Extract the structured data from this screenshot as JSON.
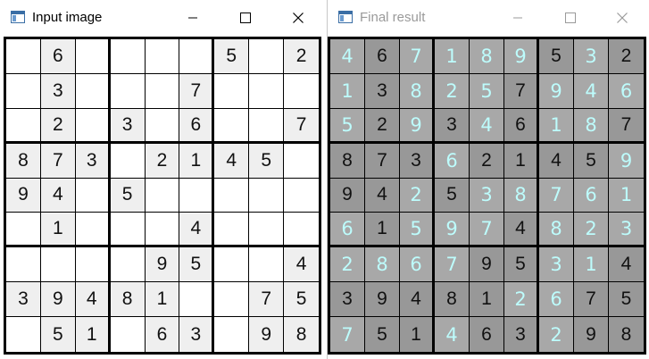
{
  "input_window": {
    "title": "Input image",
    "controls": {
      "minimize": "minimize-icon",
      "maximize": "maximize-icon",
      "close": "close-icon"
    },
    "grid": [
      [
        "",
        "6",
        "",
        "",
        "",
        "",
        "5",
        "",
        "2"
      ],
      [
        "",
        "3",
        "",
        "",
        "",
        "7",
        "",
        "",
        ""
      ],
      [
        "",
        "2",
        "",
        "3",
        "",
        "6",
        "",
        "",
        "7"
      ],
      [
        "8",
        "7",
        "3",
        "",
        "2",
        "1",
        "4",
        "5",
        ""
      ],
      [
        "9",
        "4",
        "",
        "5",
        "",
        "",
        "",
        "",
        ""
      ],
      [
        "",
        "1",
        "",
        "",
        "",
        "4",
        "",
        "",
        ""
      ],
      [
        "",
        "",
        "",
        "",
        "9",
        "5",
        "",
        "",
        "4"
      ],
      [
        "3",
        "9",
        "4",
        "8",
        "1",
        "",
        "",
        "7",
        "5"
      ],
      [
        "",
        "5",
        "1",
        "",
        "6",
        "3",
        "",
        "9",
        "8"
      ]
    ]
  },
  "result_window": {
    "title": "Final result",
    "controls": {
      "minimize": "minimize-icon",
      "maximize": "maximize-icon",
      "close": "close-icon"
    },
    "grid": [
      [
        "4",
        "6",
        "7",
        "1",
        "8",
        "9",
        "5",
        "3",
        "2"
      ],
      [
        "1",
        "3",
        "8",
        "2",
        "5",
        "7",
        "9",
        "4",
        "6"
      ],
      [
        "5",
        "2",
        "9",
        "3",
        "4",
        "6",
        "1",
        "8",
        "7"
      ],
      [
        "8",
        "7",
        "3",
        "6",
        "2",
        "1",
        "4",
        "5",
        "9"
      ],
      [
        "9",
        "4",
        "2",
        "5",
        "3",
        "8",
        "7",
        "6",
        "1"
      ],
      [
        "6",
        "1",
        "5",
        "9",
        "7",
        "4",
        "8",
        "2",
        "3"
      ],
      [
        "2",
        "8",
        "6",
        "7",
        "9",
        "5",
        "3",
        "1",
        "4"
      ],
      [
        "3",
        "9",
        "4",
        "8",
        "1",
        "2",
        "6",
        "7",
        "5"
      ],
      [
        "7",
        "5",
        "1",
        "4",
        "6",
        "3",
        "2",
        "9",
        "8"
      ]
    ]
  },
  "colors": {
    "given_digit": "#111111",
    "solved_digit": "#bdfcfc",
    "result_cell": "#a8a8a8",
    "result_cell_dark": "#989898",
    "input_filled_cell": "#efefef"
  }
}
